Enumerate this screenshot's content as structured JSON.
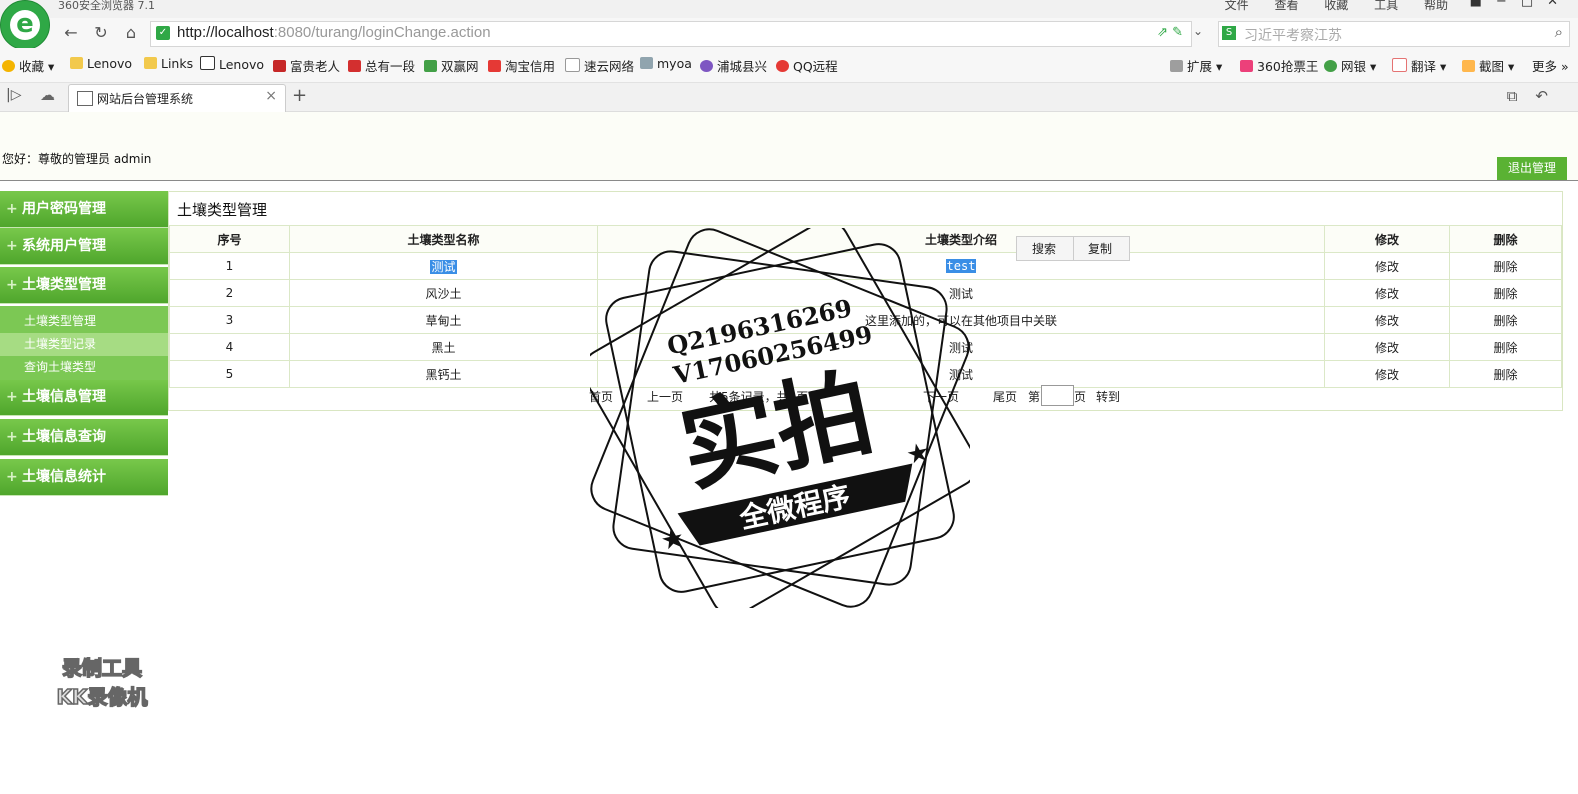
{
  "browser": {
    "app_title": "360安全浏览器 7.1",
    "menu": [
      "文件",
      "查看",
      "收藏",
      "工具",
      "帮助"
    ],
    "url_host": "http://localhost",
    "url_rest": ":8080/turang/loginChange.action",
    "search_text": "习近平考察江苏",
    "favorites": [
      "收藏",
      "Lenovo",
      "Links",
      "Lenovo",
      "富贵老人",
      "总有一段",
      "双赢网",
      "淘宝信用",
      "速云网络",
      "myoa",
      "浦城县兴",
      "QQ远程"
    ],
    "fav_right": [
      "扩展",
      "360抢票王",
      "网银",
      "翻译",
      "截图",
      "更多"
    ],
    "tab_label": "网站后台管理系统"
  },
  "header": {
    "greeting": "您好：尊敬的管理员  admin",
    "logout_label": "退出管理"
  },
  "sidebar": {
    "items": [
      {
        "label": "用户密码管理"
      },
      {
        "label": "系统用户管理"
      },
      {
        "label": "土壤类型管理"
      },
      {
        "label": "土壤信息管理"
      },
      {
        "label": "土壤信息查询"
      },
      {
        "label": "土壤信息统计"
      }
    ],
    "subitems": [
      {
        "label": "土壤类型管理"
      },
      {
        "label": "土壤类型记录"
      },
      {
        "label": "查询土壤类型"
      }
    ]
  },
  "main": {
    "title": "土壤类型管理",
    "columns": [
      "序号",
      "土壤类型名称",
      "土壤类型介绍",
      "修改",
      "删除"
    ],
    "rows": [
      {
        "no": "1",
        "name": "测试",
        "desc": "test",
        "edit": "修改",
        "del": "删除"
      },
      {
        "no": "2",
        "name": "风沙土",
        "desc": "测试",
        "edit": "修改",
        "del": "删除"
      },
      {
        "no": "3",
        "name": "草甸土",
        "desc": "这里添加的，可以在其他项目中关联",
        "edit": "修改",
        "del": "删除"
      },
      {
        "no": "4",
        "name": "黑土",
        "desc": "测试",
        "edit": "修改",
        "del": "删除"
      },
      {
        "no": "5",
        "name": "黑钙土",
        "desc": "测试",
        "edit": "修改",
        "del": "删除"
      }
    ],
    "pager": {
      "first": "首页",
      "prev": "上一页",
      "info": "共5条记录，共1页",
      "next": "下一页",
      "last": "尾页",
      "page_prefix": "第",
      "page_suffix": "页",
      "goto": "转到"
    }
  },
  "context_menu": {
    "search": "搜索",
    "copy": "复制"
  },
  "watermark": {
    "line1": "Q2196316269",
    "line2": "V17060256499",
    "big": "实拍",
    "banner": "全微程序",
    "kk_line1": "录制工具",
    "kk_line2": "KK录像机"
  }
}
